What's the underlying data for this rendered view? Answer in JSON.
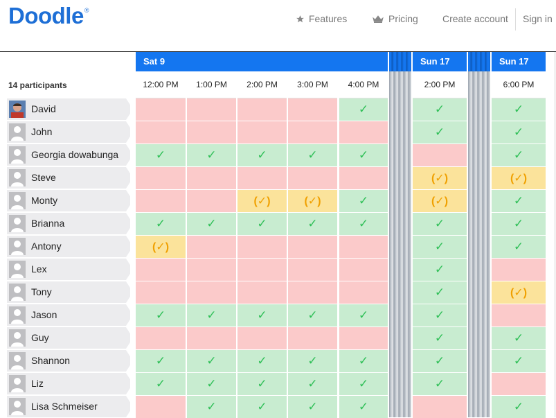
{
  "brand": {
    "name": "Doodle",
    "mark": "®"
  },
  "nav": [
    {
      "label": "Features",
      "icon": "star-icon"
    },
    {
      "label": "Pricing",
      "icon": "crown-icon"
    },
    {
      "label": "Create account"
    },
    {
      "label": "Sign in"
    }
  ],
  "participants_label": "14 participants",
  "dates": [
    "Sat 9",
    "Sun 17",
    "Sun 17"
  ],
  "times": [
    "12:00 PM",
    "1:00 PM",
    "2:00 PM",
    "3:00 PM",
    "4:00 PM",
    "2:00 PM",
    "6:00 PM"
  ],
  "legend": {
    "yes": "✓",
    "maybe": "(✓)"
  },
  "rows": [
    {
      "name": "David",
      "votes": [
        "no",
        "no",
        "no",
        "no",
        "yes",
        "yes",
        "yes"
      ]
    },
    {
      "name": "John",
      "votes": [
        "no",
        "no",
        "no",
        "no",
        "no",
        "yes",
        "yes"
      ]
    },
    {
      "name": "Georgia dowabunga",
      "votes": [
        "yes",
        "yes",
        "yes",
        "yes",
        "yes",
        "no",
        "yes"
      ]
    },
    {
      "name": "Steve",
      "votes": [
        "no",
        "no",
        "no",
        "no",
        "no",
        "maybe",
        "maybe"
      ]
    },
    {
      "name": "Monty",
      "votes": [
        "no",
        "no",
        "maybe",
        "maybe",
        "yes",
        "maybe",
        "yes"
      ]
    },
    {
      "name": "Brianna",
      "votes": [
        "yes",
        "yes",
        "yes",
        "yes",
        "yes",
        "yes",
        "yes"
      ]
    },
    {
      "name": "Antony",
      "votes": [
        "maybe",
        "no",
        "no",
        "no",
        "no",
        "yes",
        "yes"
      ]
    },
    {
      "name": "Lex",
      "votes": [
        "no",
        "no",
        "no",
        "no",
        "no",
        "yes",
        "no"
      ]
    },
    {
      "name": "Tony",
      "votes": [
        "no",
        "no",
        "no",
        "no",
        "no",
        "yes",
        "maybe"
      ]
    },
    {
      "name": "Jason",
      "votes": [
        "yes",
        "yes",
        "yes",
        "yes",
        "yes",
        "yes",
        "no"
      ]
    },
    {
      "name": "Guy",
      "votes": [
        "no",
        "no",
        "no",
        "no",
        "no",
        "yes",
        "yes"
      ]
    },
    {
      "name": "Shannon",
      "votes": [
        "yes",
        "yes",
        "yes",
        "yes",
        "yes",
        "yes",
        "yes"
      ]
    },
    {
      "name": "Liz",
      "votes": [
        "yes",
        "yes",
        "yes",
        "yes",
        "yes",
        "yes",
        "no"
      ]
    },
    {
      "name": "Lisa Schmeiser",
      "votes": [
        "no",
        "yes",
        "yes",
        "yes",
        "yes",
        "no",
        "yes"
      ]
    }
  ],
  "colors": {
    "yes": "#c8ecd0",
    "no": "#fbcaca",
    "maybe": "#fbe39b",
    "brand": "#1e6fd6",
    "datebar": "#1476f0"
  }
}
